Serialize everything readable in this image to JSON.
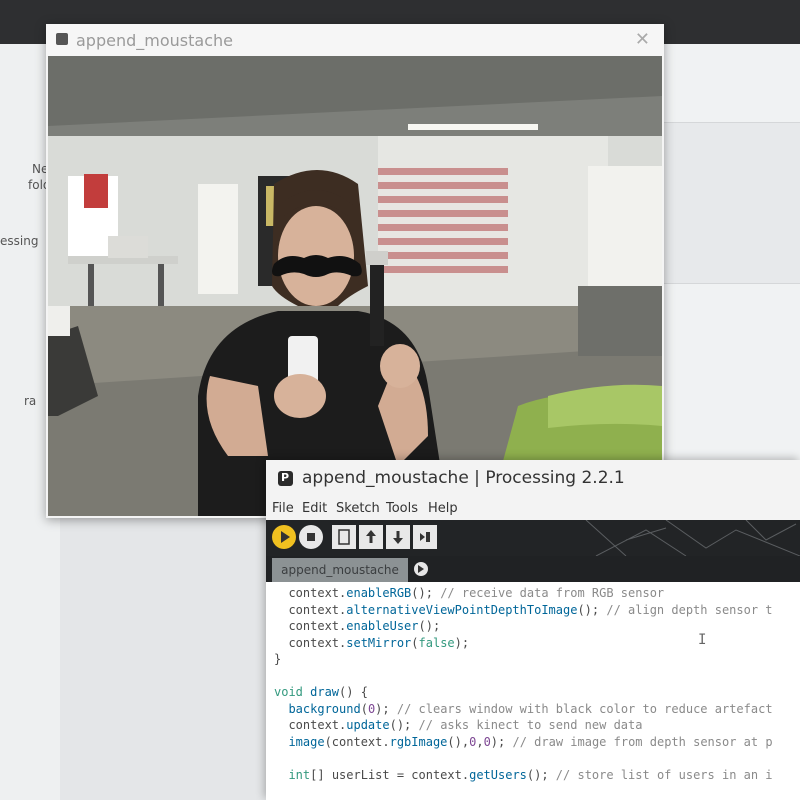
{
  "desktop": {
    "left_fragments": [
      "Ne",
      "fold",
      "essing",
      "ra"
    ]
  },
  "sketch_window": {
    "title": "append_moustache",
    "close_glyph": "✕"
  },
  "editor_window": {
    "title": "append_moustache | Processing 2.2.1",
    "menu": [
      "File",
      "Edit",
      "Sketch",
      "Tools",
      "Help"
    ],
    "toolbar": {
      "buttons": [
        "run-icon",
        "stop-icon",
        "new-icon",
        "open-icon",
        "save-icon",
        "export-icon"
      ],
      "accent_color": "#f0c020"
    },
    "tab": {
      "label": "append_moustache"
    },
    "code_lines": [
      [
        {
          "t": "  context.",
          "c": "tx"
        },
        {
          "t": "enableRGB",
          "c": "fn"
        },
        {
          "t": "(); ",
          "c": "tx"
        },
        {
          "t": "// receive data from RGB sensor",
          "c": "cm"
        }
      ],
      [
        {
          "t": "  context.",
          "c": "tx"
        },
        {
          "t": "alternativeViewPointDepthToImage",
          "c": "fn"
        },
        {
          "t": "(); ",
          "c": "tx"
        },
        {
          "t": "// align depth sensor t",
          "c": "cm"
        }
      ],
      [
        {
          "t": "  context.",
          "c": "tx"
        },
        {
          "t": "enableUser",
          "c": "fn"
        },
        {
          "t": "();",
          "c": "tx"
        }
      ],
      [
        {
          "t": "  context.",
          "c": "tx"
        },
        {
          "t": "setMirror",
          "c": "fn"
        },
        {
          "t": "(",
          "c": "tx"
        },
        {
          "t": "false",
          "c": "kw"
        },
        {
          "t": ");",
          "c": "tx"
        }
      ],
      [
        {
          "t": "}",
          "c": "tx"
        }
      ],
      [
        {
          "t": "",
          "c": "tx"
        }
      ],
      [
        {
          "t": "void ",
          "c": "kw"
        },
        {
          "t": "draw",
          "c": "fn"
        },
        {
          "t": "() {",
          "c": "tx"
        }
      ],
      [
        {
          "t": "  ",
          "c": "tx"
        },
        {
          "t": "background",
          "c": "fn"
        },
        {
          "t": "(",
          "c": "tx"
        },
        {
          "t": "0",
          "c": "num"
        },
        {
          "t": "); ",
          "c": "tx"
        },
        {
          "t": "// clears window with black color to reduce artefact",
          "c": "cm"
        }
      ],
      [
        {
          "t": "  context.",
          "c": "tx"
        },
        {
          "t": "update",
          "c": "fn"
        },
        {
          "t": "(); ",
          "c": "tx"
        },
        {
          "t": "// asks kinect to send new data",
          "c": "cm"
        }
      ],
      [
        {
          "t": "  ",
          "c": "tx"
        },
        {
          "t": "image",
          "c": "fn"
        },
        {
          "t": "(context.",
          "c": "tx"
        },
        {
          "t": "rgbImage",
          "c": "fn"
        },
        {
          "t": "(),",
          "c": "tx"
        },
        {
          "t": "0",
          "c": "num"
        },
        {
          "t": ",",
          "c": "tx"
        },
        {
          "t": "0",
          "c": "num"
        },
        {
          "t": "); ",
          "c": "tx"
        },
        {
          "t": "// draw image from depth sensor at p",
          "c": "cm"
        }
      ],
      [
        {
          "t": "",
          "c": "tx"
        }
      ],
      [
        {
          "t": "  ",
          "c": "tx"
        },
        {
          "t": "int",
          "c": "kw"
        },
        {
          "t": "[] userList = context.",
          "c": "tx"
        },
        {
          "t": "getUsers",
          "c": "fn"
        },
        {
          "t": "(); ",
          "c": "tx"
        },
        {
          "t": "// store list of users in an i",
          "c": "cm"
        }
      ]
    ]
  }
}
